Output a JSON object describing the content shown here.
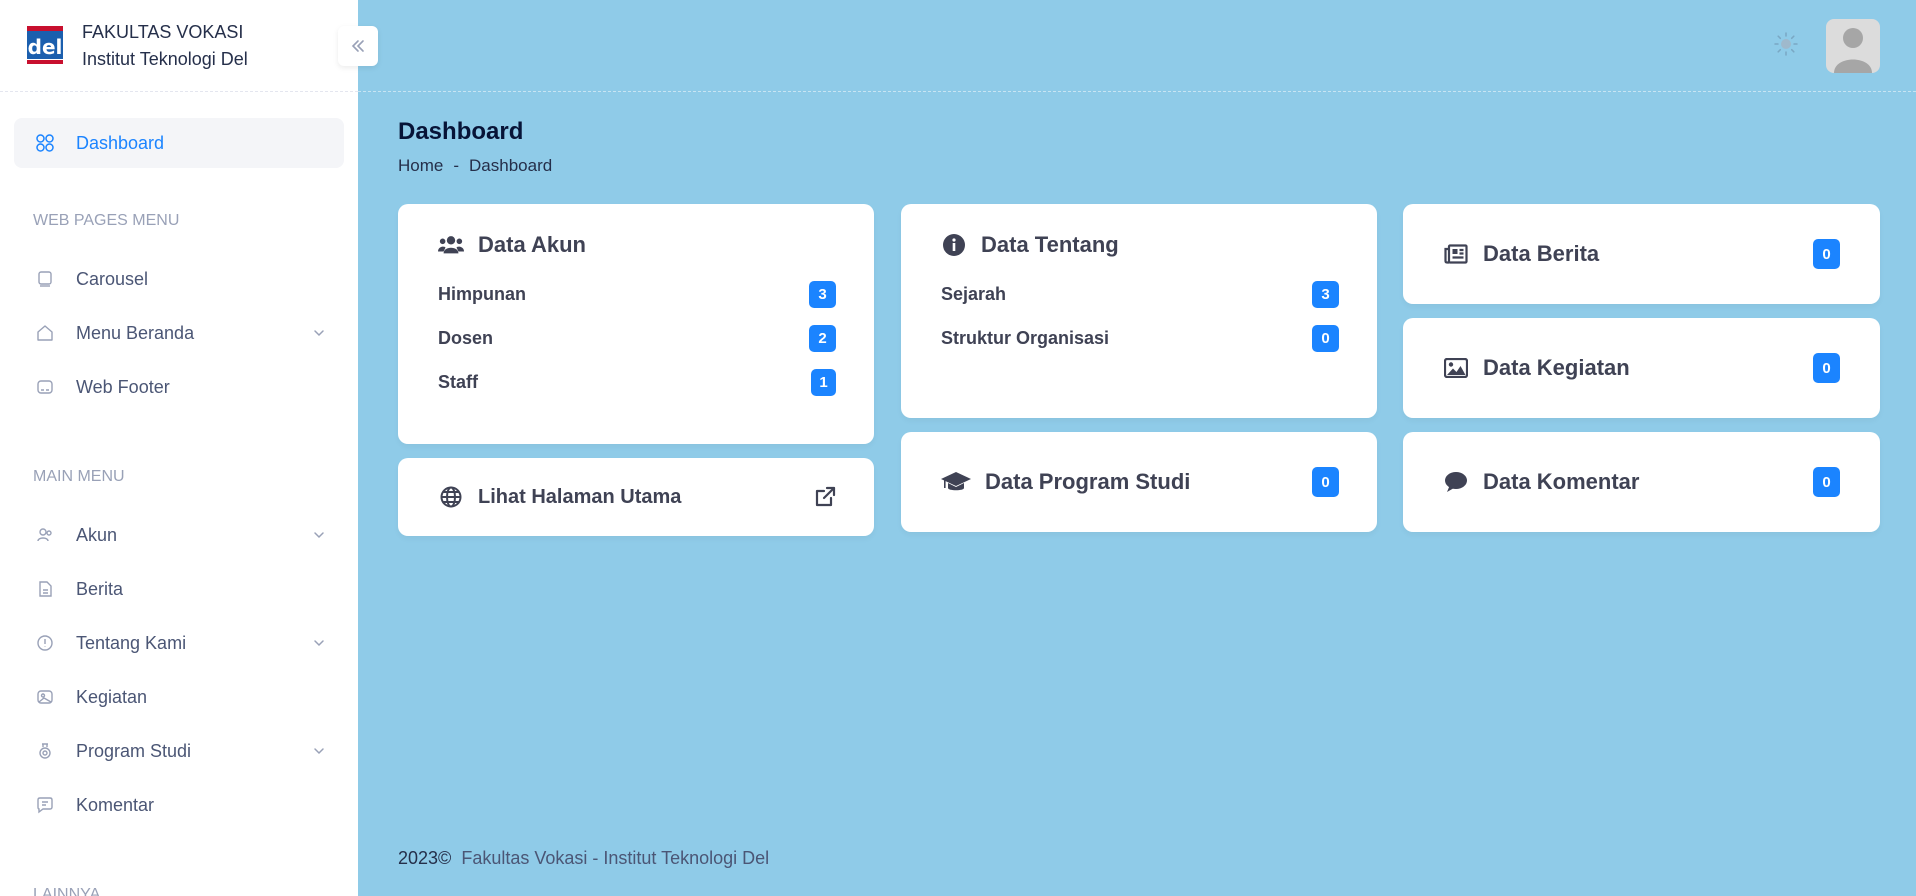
{
  "brand": {
    "line1": "FAKULTAS VOKASI",
    "line2": "Institut Teknologi Del",
    "logo_text": "del"
  },
  "sidebar": {
    "active": {
      "label": "Dashboard",
      "icon": "dashboard-grid-icon"
    },
    "sections": [
      {
        "title": "WEB PAGES MENU",
        "items": [
          {
            "label": "Carousel",
            "icon": "carousel-icon",
            "has_submenu": false
          },
          {
            "label": "Menu Beranda",
            "icon": "home-icon",
            "has_submenu": true
          },
          {
            "label": "Web Footer",
            "icon": "footer-icon",
            "has_submenu": false
          }
        ]
      },
      {
        "title": "MAIN MENU",
        "items": [
          {
            "label": "Akun",
            "icon": "users-icon",
            "has_submenu": true
          },
          {
            "label": "Berita",
            "icon": "document-icon",
            "has_submenu": false
          },
          {
            "label": "Tentang Kami",
            "icon": "info-icon",
            "has_submenu": true
          },
          {
            "label": "Kegiatan",
            "icon": "image-icon",
            "has_submenu": false
          },
          {
            "label": "Program Studi",
            "icon": "study-icon",
            "has_submenu": true
          },
          {
            "label": "Komentar",
            "icon": "comment-icon",
            "has_submenu": false
          }
        ]
      },
      {
        "title": "LAINNYA",
        "items": []
      }
    ]
  },
  "page": {
    "title": "Dashboard",
    "breadcrumb": {
      "home": "Home",
      "sep": "-",
      "current": "Dashboard"
    }
  },
  "cards": {
    "akun": {
      "title": "Data Akun",
      "rows": [
        {
          "label": "Himpunan",
          "count": "3"
        },
        {
          "label": "Dosen",
          "count": "2"
        },
        {
          "label": "Staff",
          "count": "1"
        }
      ]
    },
    "tentang": {
      "title": "Data Tentang",
      "rows": [
        {
          "label": "Sejarah",
          "count": "3"
        },
        {
          "label": "Struktur Organisasi",
          "count": "0"
        }
      ]
    },
    "berita": {
      "title": "Data Berita",
      "count": "0"
    },
    "kegiatan": {
      "title": "Data Kegiatan",
      "count": "0"
    },
    "halaman": {
      "title": "Lihat Halaman Utama"
    },
    "prodi": {
      "title": "Data Program Studi",
      "count": "0"
    },
    "komentar": {
      "title": "Data Komentar",
      "count": "0"
    }
  },
  "footer": {
    "year": "2023©",
    "text": "Fakultas Vokasi - Institut Teknologi Del"
  },
  "colors": {
    "accent": "#1b84ff",
    "background": "#8fcbe8",
    "badge": "#1b84ff"
  }
}
